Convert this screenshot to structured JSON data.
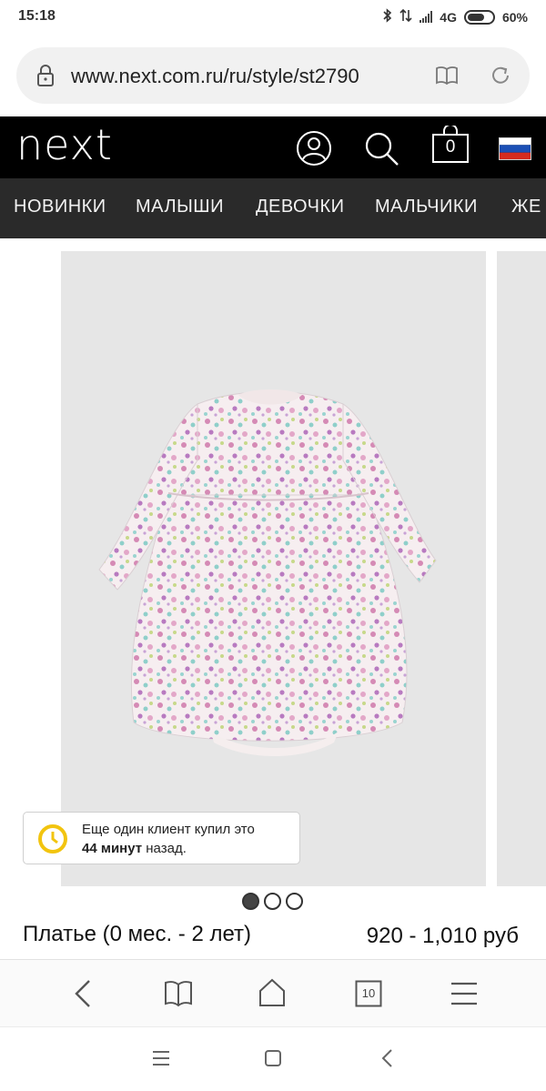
{
  "status_bar": {
    "time": "15:18",
    "network": "4G",
    "battery": "60%"
  },
  "url_bar": {
    "url": "www.next.com.ru/ru/style/st2790"
  },
  "header": {
    "logo": "next",
    "bag_count": "0"
  },
  "nav": {
    "items": [
      "НОВИНКИ",
      "МАЛЫШИ",
      "ДЕВОЧКИ",
      "МАЛЬЧИКИ",
      "ЖЕ"
    ]
  },
  "toast": {
    "line1": "Еще один клиент купил это",
    "minutes": "44 минут",
    "suffix": " назад."
  },
  "product": {
    "name": "Платье (0 мес. - 2 лет)",
    "price": "920 - 1,010 руб"
  },
  "carousel": {
    "count": 3,
    "active_index": 0
  },
  "browser_bar": {
    "tabs_count": "10"
  },
  "colors": {
    "header_bg": "#000000",
    "nav_bg": "#2a2a2a",
    "toast_clock": "#f2c40f"
  }
}
